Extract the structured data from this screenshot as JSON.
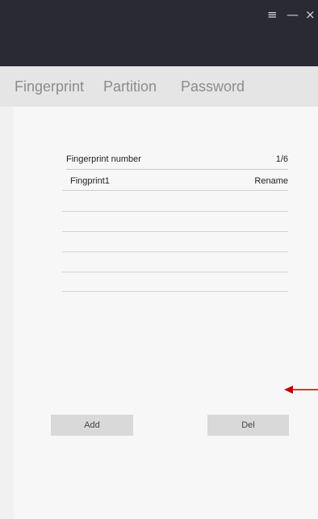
{
  "window": {
    "menu_glyph": "≡",
    "minimize_glyph": "—",
    "close_glyph": "×"
  },
  "tabs": [
    {
      "label": "Fingerprint"
    },
    {
      "label": "Partition"
    },
    {
      "label": "Password"
    }
  ],
  "fingerprint_list": {
    "header_label": "Fingerprint number",
    "count": "1/6",
    "items": [
      {
        "name": "Fingprint1",
        "action": "Rename"
      }
    ]
  },
  "buttons": {
    "add": "Add",
    "del": "Del"
  },
  "colors": {
    "titlebar": "#2a2a35",
    "tabbar": "#e5e5e5",
    "annotation_arrow": "#c00000"
  },
  "icons": {
    "menu": "hamburger-menu-icon",
    "minimize": "minimize-icon",
    "close": "close-icon",
    "annotation": "left-arrow-icon"
  }
}
